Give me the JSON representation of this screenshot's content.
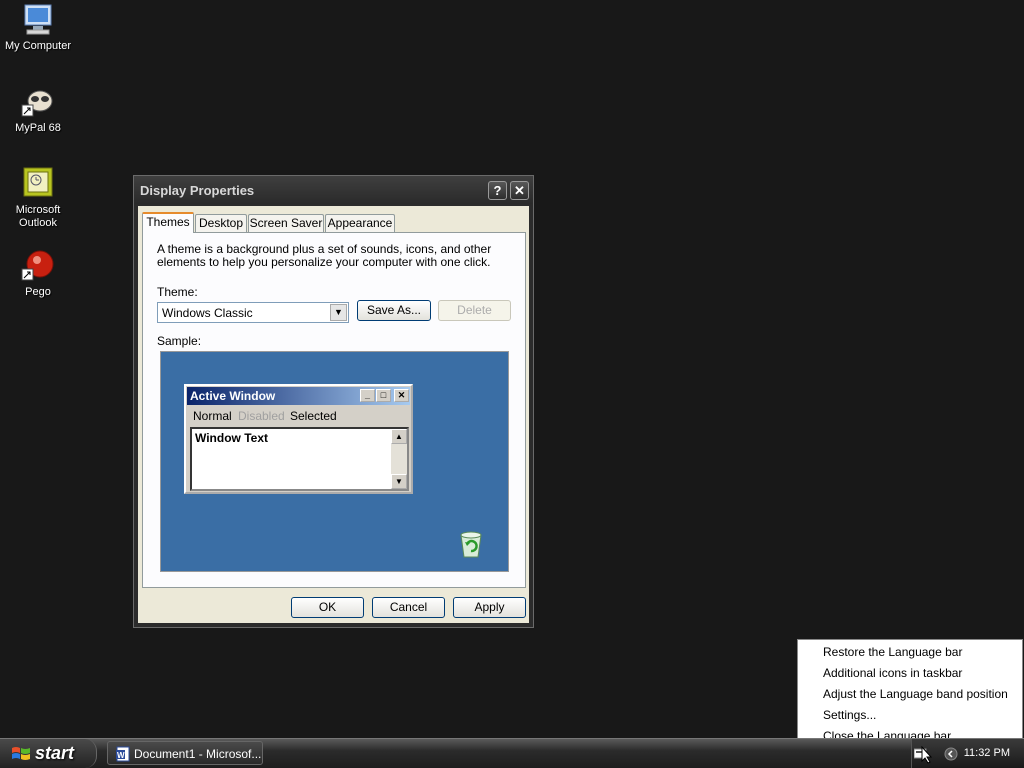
{
  "desktop": {
    "icons": [
      {
        "label": "My Computer"
      },
      {
        "label": "MyPal 68"
      },
      {
        "label": "Microsoft Outlook"
      },
      {
        "label": "Pego"
      }
    ]
  },
  "dialog": {
    "title": "Display Properties",
    "help_glyph": "?",
    "close_glyph": "✕",
    "tabs": [
      "Themes",
      "Desktop",
      "Screen Saver",
      "Appearance"
    ],
    "description": "A theme is a background plus a set of sounds, icons, and other elements to help you personalize your computer with one click.",
    "theme_label": "Theme:",
    "theme_value": "Windows Classic",
    "save_as_label": "Save As...",
    "delete_label": "Delete",
    "sample_label": "Sample:",
    "sample": {
      "window_title": "Active Window",
      "menu": [
        "Normal",
        "Disabled",
        "Selected"
      ],
      "window_text": "Window Text"
    },
    "ok_label": "OK",
    "cancel_label": "Cancel",
    "apply_label": "Apply"
  },
  "taskbar": {
    "start_label": "start",
    "task_button_label": "Document1 - Microsof...",
    "clock": "11:32 PM"
  },
  "context_menu": {
    "items": [
      {
        "label": "Restore the Language bar"
      },
      {
        "label": "Additional icons in taskbar"
      },
      {
        "label": "Adjust the Language band position"
      },
      {
        "label": "Settings..."
      },
      {
        "label": "Close the Language bar"
      }
    ]
  },
  "colors": {
    "desktop": "#181818",
    "sample_desktop": "#3a6ea5",
    "active_title": "#0a246a"
  }
}
